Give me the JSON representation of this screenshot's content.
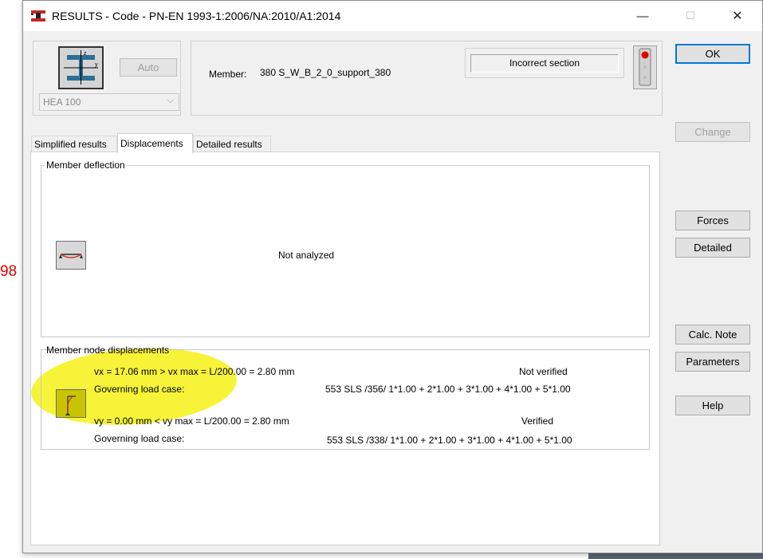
{
  "background": {
    "side_text": "98"
  },
  "window": {
    "title": "RESULTS - Code - PN-EN 1993-1:2006/NA:2010/A1:2014",
    "controls": {
      "minimize": "—",
      "maximize": "☐",
      "close": "✕"
    }
  },
  "header": {
    "auto_label": "Auto",
    "section_value": "HEA 100",
    "member_label": "Member:",
    "member_value": "380  S_W_B_2_0_support_380",
    "status_text": "Incorrect section",
    "status_color": "#e00000"
  },
  "buttons": {
    "ok": "OK",
    "change": "Change",
    "forces": "Forces",
    "detailed": "Detailed",
    "calc_note": "Calc. Note",
    "parameters": "Parameters",
    "help": "Help"
  },
  "tabs": [
    {
      "label": "Simplified results",
      "active": false
    },
    {
      "label": "Displacements",
      "active": true
    },
    {
      "label": "Detailed results",
      "active": false
    }
  ],
  "deflection": {
    "title": "Member deflection",
    "status": "Not analyzed"
  },
  "node_displacements": {
    "title": "Member node displacements",
    "vx": {
      "check": "vx = 17.06 mm  >  vx max = L/200.00 = 2.80 mm",
      "result": "Not verified",
      "case_label": "Governing load case:",
      "case_value": "553 SLS /356/  1*1.00 + 2*1.00 + 3*1.00 + 4*1.00 + 5*1.00"
    },
    "vy": {
      "check": "vy = 0.00 mm  <  vy max = L/200.00 = 2.80 mm",
      "result": "Verified",
      "case_label": "Governing load case:",
      "case_value": "553 SLS /338/  1*1.00 + 2*1.00 + 3*1.00 + 4*1.00 + 5*1.00"
    }
  },
  "colors": {
    "highlight": "#f5f000",
    "accent": "#0078d7"
  }
}
